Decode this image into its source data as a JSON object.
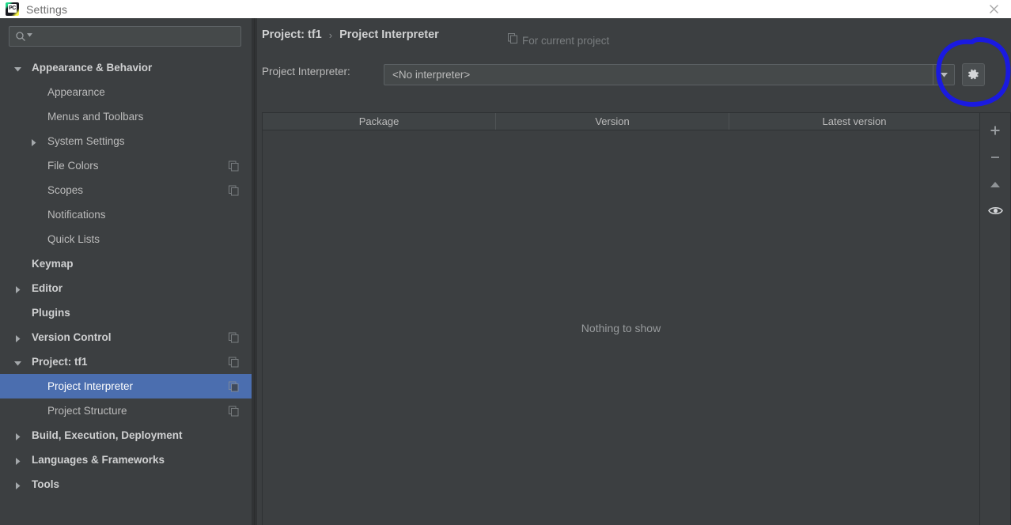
{
  "window": {
    "title": "Settings",
    "app_icon": "pycharm-logo",
    "app_icon_text": "PC",
    "close_icon": "close-icon"
  },
  "sidebar": {
    "search": {
      "placeholder": "",
      "value": "",
      "icon": "search-icon",
      "dropdown_icon": "chevron-down-icon"
    },
    "items": [
      {
        "label": "Appearance & Behavior",
        "indent": 0,
        "bold": true,
        "arrow": "down",
        "copy": false,
        "selected": false
      },
      {
        "label": "Appearance",
        "indent": 1,
        "bold": false,
        "arrow": "none",
        "copy": false,
        "selected": false
      },
      {
        "label": "Menus and Toolbars",
        "indent": 1,
        "bold": false,
        "arrow": "none",
        "copy": false,
        "selected": false
      },
      {
        "label": "System Settings",
        "indent": 1,
        "bold": false,
        "arrow": "right",
        "copy": false,
        "selected": false
      },
      {
        "label": "File Colors",
        "indent": 1,
        "bold": false,
        "arrow": "none",
        "copy": true,
        "selected": false
      },
      {
        "label": "Scopes",
        "indent": 1,
        "bold": false,
        "arrow": "none",
        "copy": true,
        "selected": false
      },
      {
        "label": "Notifications",
        "indent": 1,
        "bold": false,
        "arrow": "none",
        "copy": false,
        "selected": false
      },
      {
        "label": "Quick Lists",
        "indent": 1,
        "bold": false,
        "arrow": "none",
        "copy": false,
        "selected": false
      },
      {
        "label": "Keymap",
        "indent": 0,
        "bold": true,
        "arrow": "none",
        "copy": false,
        "selected": false
      },
      {
        "label": "Editor",
        "indent": 0,
        "bold": true,
        "arrow": "right",
        "copy": false,
        "selected": false
      },
      {
        "label": "Plugins",
        "indent": 0,
        "bold": true,
        "arrow": "none",
        "copy": false,
        "selected": false
      },
      {
        "label": "Version Control",
        "indent": 0,
        "bold": true,
        "arrow": "right",
        "copy": true,
        "selected": false
      },
      {
        "label": "Project: tf1",
        "indent": 0,
        "bold": true,
        "arrow": "down",
        "copy": true,
        "selected": false
      },
      {
        "label": "Project Interpreter",
        "indent": 1,
        "bold": false,
        "arrow": "none",
        "copy": true,
        "selected": true
      },
      {
        "label": "Project Structure",
        "indent": 1,
        "bold": false,
        "arrow": "none",
        "copy": true,
        "selected": false
      },
      {
        "label": "Build, Execution, Deployment",
        "indent": 0,
        "bold": true,
        "arrow": "right",
        "copy": false,
        "selected": false
      },
      {
        "label": "Languages & Frameworks",
        "indent": 0,
        "bold": true,
        "arrow": "right",
        "copy": false,
        "selected": false
      },
      {
        "label": "Tools",
        "indent": 0,
        "bold": true,
        "arrow": "right",
        "copy": false,
        "selected": false
      }
    ]
  },
  "main": {
    "breadcrumb": {
      "root": "Project: tf1",
      "separator": "›",
      "leaf": "Project Interpreter"
    },
    "scope_hint": {
      "icon": "copy-icon",
      "text": "For current project"
    },
    "interpreter": {
      "label": "Project Interpreter:",
      "value": "<No interpreter>",
      "dropdown_icon": "chevron-down-icon",
      "settings_icon": "gear-icon"
    },
    "table": {
      "columns": [
        "Package",
        "Version",
        "Latest version"
      ],
      "rows": [],
      "empty_text": "Nothing to show"
    },
    "toolbar": [
      {
        "name": "add-package-button",
        "icon": "plus-icon"
      },
      {
        "name": "remove-package-button",
        "icon": "minus-icon"
      },
      {
        "name": "upgrade-package-button",
        "icon": "arrow-up-icon"
      },
      {
        "name": "show-early-releases-button",
        "icon": "eye-icon"
      }
    ]
  },
  "annotation": {
    "shape": "hand-drawn-circle",
    "color": "#1a1ae0",
    "target": "gear-icon"
  },
  "colors": {
    "titlebar_bg": "#ffffff",
    "panel_bg": "#3c3f41",
    "selection_blue": "#4b6eaf",
    "text": "#bbbbbb",
    "annotation": "#1a1ae0"
  }
}
